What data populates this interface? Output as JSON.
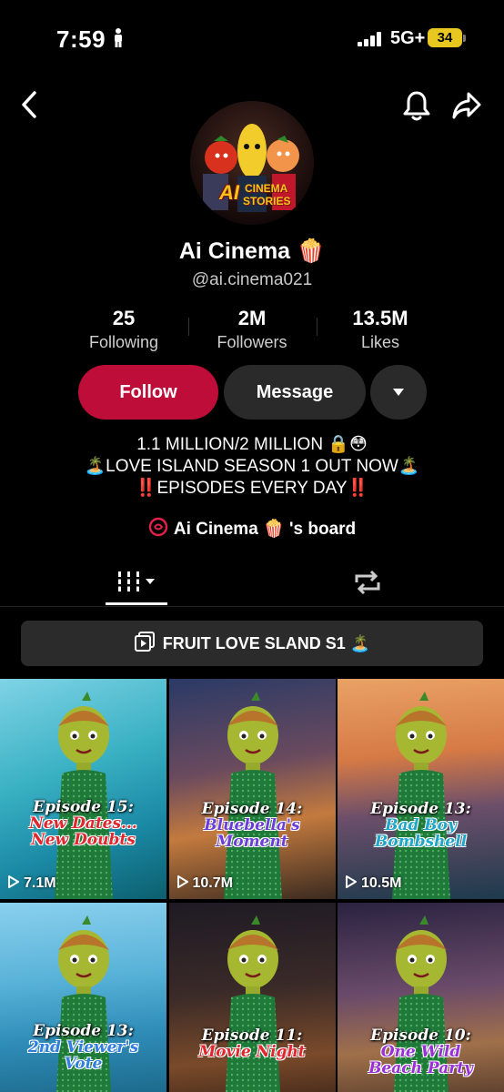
{
  "status": {
    "time": "7:59",
    "network": "5G+",
    "battery": "34"
  },
  "profile": {
    "avatar_text_top": "CINEMA",
    "avatar_text_bottom": "STORIES",
    "avatar_ai": "AI",
    "display_name": "Ai Cinema 🍿",
    "username": "@ai.cinema021"
  },
  "stats": [
    {
      "value": "25",
      "label": "Following"
    },
    {
      "value": "2M",
      "label": "Followers"
    },
    {
      "value": "13.5M",
      "label": "Likes"
    }
  ],
  "buttons": {
    "follow": "Follow",
    "message": "Message"
  },
  "bio": [
    "1.1 MILLION/2 MILLION 🔒😳",
    "🏝️LOVE ISLAND SEASON 1 OUT NOW🏝️",
    "‼️EPISODES EVERY DAY‼️"
  ],
  "board": {
    "label": "Ai Cinema 🍿 's board"
  },
  "playlist": {
    "label": "FRUIT LOVE SLAND S1 🏝️"
  },
  "videos": [
    {
      "episode": "Episode 15:",
      "title1": "New Dates...",
      "title2": "New Doubts",
      "views": "7.1M",
      "title_color": "#e0262e",
      "bg": "linear-gradient(160deg,#7fd3e6 0%,#3bb2c4 40%,#1b8aa6 70%,#0c5f6e 100%)"
    },
    {
      "episode": "Episode 14:",
      "title1": "Bluebella's",
      "title2": "Moment",
      "views": "10.7M",
      "title_color": "#6b3ed9",
      "bg": "linear-gradient(170deg,#2a3a66 0%,#6a4a5e 40%,#c37a3e 65%,#3a2a20 100%)"
    },
    {
      "episode": "Episode 13:",
      "title1": "Bad Boy",
      "title2": "Bombshell",
      "views": "10.5M",
      "title_color": "#1ea7c9",
      "bg": "linear-gradient(175deg,#e9a265 0%,#d67a45 35%,#6b4e6a 60%,#1d3a4c 100%)"
    },
    {
      "episode": "Episode 13:",
      "title1": "2nd Viewer's",
      "title2": "Vote",
      "views": "",
      "title_color": "#2f7ee0",
      "bg": "linear-gradient(175deg,#8ad0ee 0%,#58b2d8 35%,#2f8db8 60%,#145a78 100%)"
    },
    {
      "episode": "Episode 11:",
      "title1": "Movie Night",
      "title2": "",
      "views": "",
      "title_color": "#e0262e",
      "bg": "linear-gradient(175deg,#1e1a24 0%,#3a2a28 40%,#7a4a2a 70%,#2a1a14 100%)"
    },
    {
      "episode": "Episode 10:",
      "title1": "One Wild",
      "title2": "Beach Party",
      "views": "",
      "title_color": "#9a2fd8",
      "bg": "linear-gradient(175deg,#2a2340 0%,#6a4a6a 40%,#a0704a 65%,#3a2820 100%)"
    }
  ]
}
